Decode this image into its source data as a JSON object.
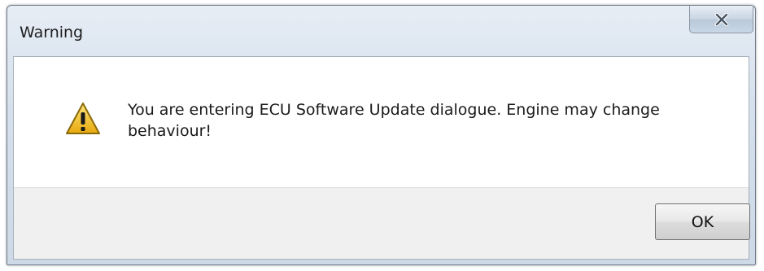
{
  "window": {
    "title": "Warning",
    "close_icon": "close-x-icon"
  },
  "dialog": {
    "icon": "warning-triangle-icon",
    "message": "You are entering ECU Software Update dialogue. Engine may change behaviour!",
    "ok_label": "OK"
  },
  "colors": {
    "warning_fill": "#f2c21b",
    "warning_outline": "#8a6a0a",
    "close_glyph": "#4b5563"
  }
}
